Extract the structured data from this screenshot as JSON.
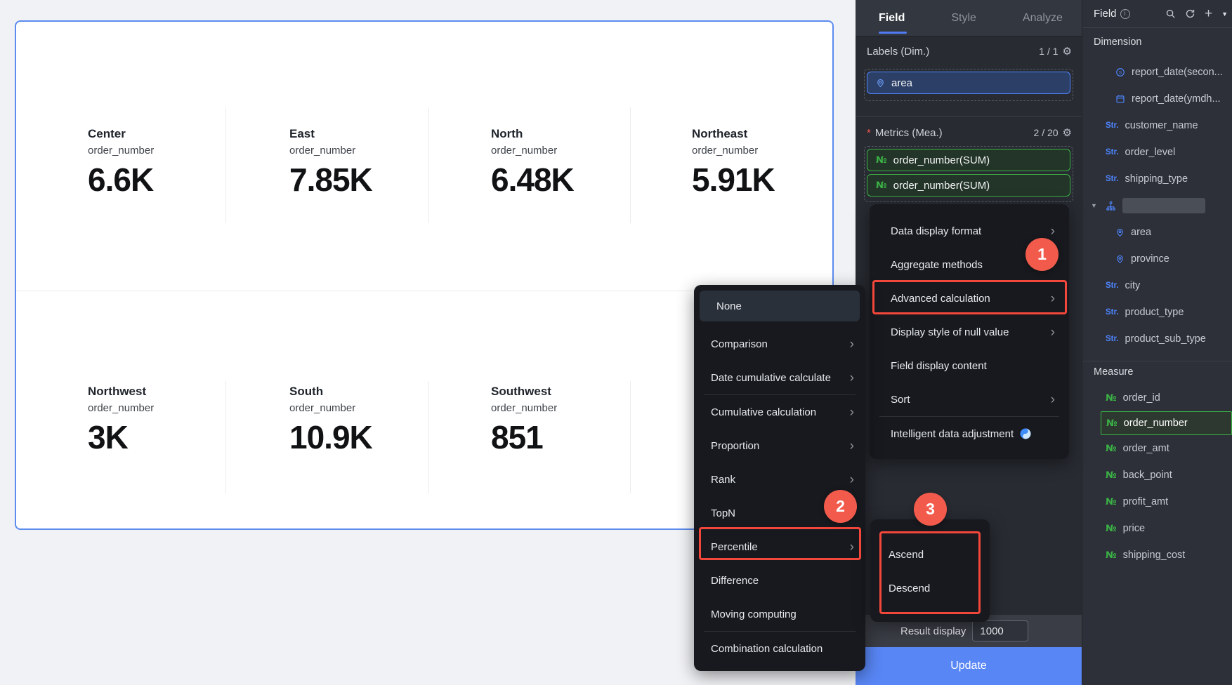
{
  "chart_data": {
    "type": "kpi_cards",
    "metric_label": "order_number",
    "categories": [
      "Center",
      "East",
      "North",
      "Northeast",
      "Northwest",
      "South",
      "Southwest"
    ],
    "values_formatted": [
      "6.6K",
      "7.85K",
      "6.48K",
      "5.91K",
      "3K",
      "10.9K",
      "851"
    ],
    "values_approx": [
      6600,
      7850,
      6480,
      5910,
      3000,
      10900,
      851
    ],
    "layout": "2 rows x 4 columns of indicator cards with divider lines, grid off, no axes"
  },
  "icons": {
    "string": "Str.",
    "number": "№",
    "gear": "⚙",
    "chevron": "›",
    "caret_down": "▼",
    "plus": "+",
    "info": "i"
  },
  "mid_panel": {
    "tabs": [
      "Field",
      "Style",
      "Analyze"
    ],
    "active_tab": "Field",
    "labels_section": {
      "title": "Labels (Dim.)",
      "count": "1 / 1",
      "chip": "area"
    },
    "metrics_section": {
      "title": "Metrics (Mea.)",
      "count": "2 / 20",
      "chips": [
        "order_number(SUM)",
        "order_number(SUM)"
      ]
    },
    "footer": {
      "label": "Result display",
      "value": "1000"
    },
    "update_button": "Update"
  },
  "menu1": {
    "items": [
      "Data display format",
      "Aggregate methods",
      "Advanced calculation",
      "Display style of null value",
      "Field display content",
      "Sort",
      "Intelligent data adjustment"
    ]
  },
  "menu2": {
    "selected": "None",
    "items": [
      "None",
      "Comparison",
      "Date cumulative calculate",
      "Cumulative calculation",
      "Proportion",
      "Rank",
      "TopN",
      "Percentile",
      "Difference",
      "Moving computing",
      "Combination calculation"
    ]
  },
  "menu3": {
    "items": [
      "Ascend",
      "Descend"
    ]
  },
  "annotations": {
    "badge1": "1",
    "badge2": "2",
    "badge3": "3"
  },
  "field_panel": {
    "title": "Field",
    "dimension_title": "Dimension",
    "measure_title": "Measure",
    "dimension_items": [
      {
        "icon": "seconds-icon",
        "label": "report_date(secon..."
      },
      {
        "icon": "calendar-icon",
        "label": "report_date(ymdh..."
      },
      {
        "icon": "string-icon",
        "label": "customer_name"
      },
      {
        "icon": "string-icon",
        "label": "order_level"
      },
      {
        "icon": "string-icon",
        "label": "shipping_type"
      },
      {
        "icon": "tree-icon",
        "label": ""
      },
      {
        "icon": "location-icon",
        "label": "area"
      },
      {
        "icon": "location-icon",
        "label": "province"
      },
      {
        "icon": "string-icon",
        "label": "city"
      },
      {
        "icon": "string-icon",
        "label": "product_type"
      },
      {
        "icon": "string-icon",
        "label": "product_sub_type"
      }
    ],
    "measure_items": [
      "order_id",
      "order_number",
      "order_amt",
      "back_point",
      "profit_amt",
      "price",
      "shipping_cost"
    ],
    "selected_measure": "order_number"
  },
  "colors": {
    "accent_blue": "#4e85ff",
    "field_green": "#3bb346",
    "annotation_red": "#f4473b",
    "update_blue": "#5886f5"
  }
}
